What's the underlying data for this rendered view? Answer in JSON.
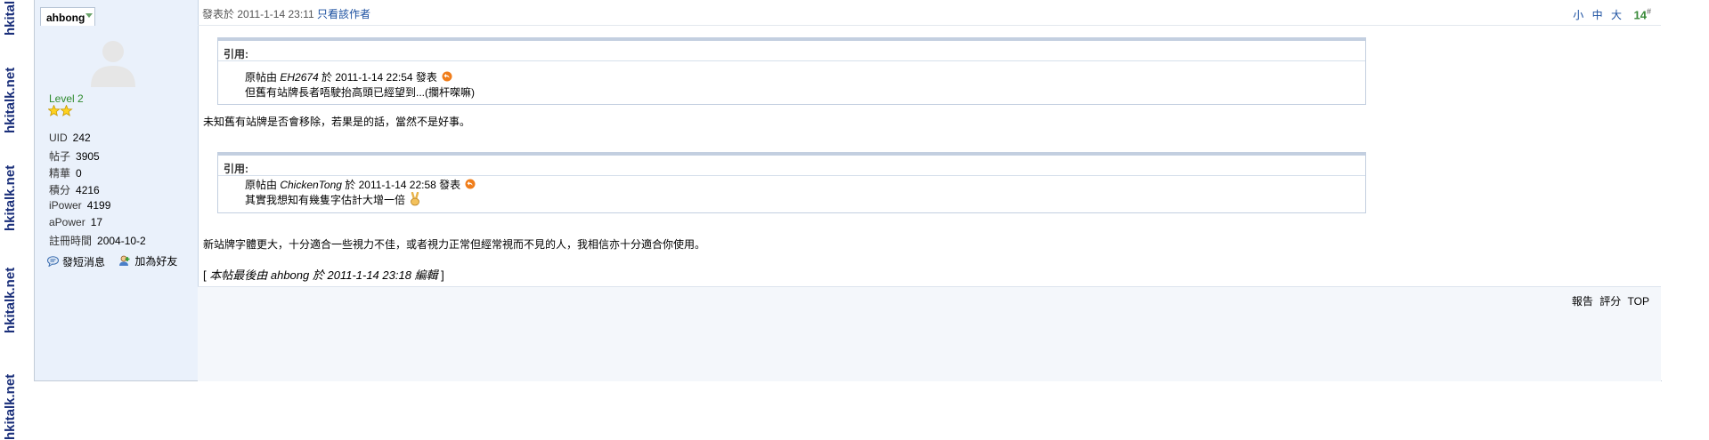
{
  "watermark": {
    "text": "hkitalk.net"
  },
  "user": {
    "name": "ahbong",
    "level": "Level 2",
    "stats": [
      {
        "label": "UID",
        "value": "242"
      },
      {
        "label": "帖子",
        "value": "3905"
      },
      {
        "label": "精華",
        "value": "0"
      },
      {
        "label": "積分",
        "value": "4216"
      },
      {
        "label": "iPower",
        "value": "4199"
      },
      {
        "label": "aPower",
        "value": "17"
      },
      {
        "label": "註冊時間",
        "value": "2004-10-2"
      }
    ],
    "actions": {
      "message": "發短消息",
      "friend": "加為好友"
    }
  },
  "post": {
    "posted_label": "發表於 2011-1-14 23:11",
    "only_author": "只看該作者",
    "font_small": "小",
    "font_medium": "中",
    "font_large": "大",
    "floor": "14",
    "floor_suffix": "#",
    "quotes": [
      {
        "label": "引用:",
        "origin_prefix": "原帖由 ",
        "author": "EH2674",
        "origin_suffix": " 於 2011-1-14 22:54 發表",
        "text": "但舊有站牌長者唔駛抬高頭已經望到...(攔杆㗎嘛)"
      },
      {
        "label": "引用:",
        "origin_prefix": "原帖由 ",
        "author": "ChickenTong",
        "origin_suffix": " 於 2011-1-14 22:58 發表",
        "text": "其實我想知有幾隻字估計大增一倍"
      }
    ],
    "reply1": "未知舊有站牌是否會移除，若果是的話，當然不是好事。",
    "reply2": "新站牌字體更大，十分適合一些視力不佳，或者視力正常但經常視而不見的人，我相信亦十分適合你使用。",
    "edit_note": {
      "open": "[ ",
      "prefix": "本帖最後由 ",
      "user": "ahbong",
      "mid": " 於 ",
      "time": "2011-1-14 23:18",
      "suffix": " 編輯",
      "close": " ]"
    },
    "footer": {
      "report": "報告",
      "rate": "評分",
      "top": "TOP"
    }
  }
}
